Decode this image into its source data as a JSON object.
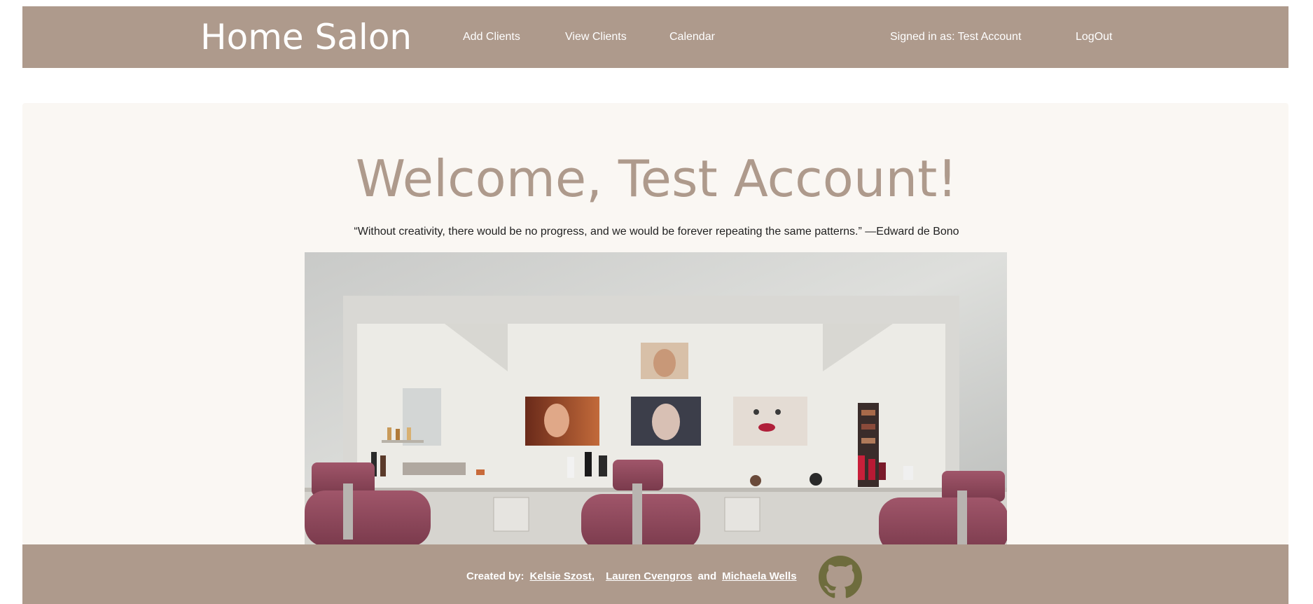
{
  "header": {
    "brand": "Home Salon",
    "nav": {
      "add_clients": "Add Clients",
      "view_clients": "View Clients",
      "calendar": "Calendar"
    },
    "signed_in": "Signed in as: Test Account",
    "logout": "LogOut"
  },
  "main": {
    "welcome": "Welcome, Test Account!",
    "quote": "“Without creativity, there would be no progress, and we would be forever repeating the same patterns.” —Edward de Bono"
  },
  "footer": {
    "created_by": "Created by:",
    "author1": "Kelsie Szost",
    "comma": ",",
    "author2": "Lauren Cvengros",
    "and": "and",
    "author3": "Michaela Wells",
    "github_icon": "github-icon"
  },
  "colors": {
    "brand": "#ae9a8c",
    "jumbotron_bg": "#faf7f3",
    "github_icon": "#6e6c3d"
  }
}
